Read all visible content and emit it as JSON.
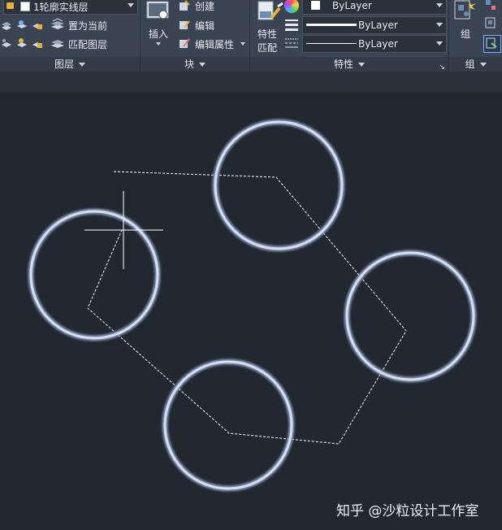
{
  "ribbon": {
    "layers_panel": {
      "title": "图层",
      "current_layer": "1轮廓实线层",
      "set_current": "置为当前",
      "match_layer": "匹配图层"
    },
    "block_panel": {
      "title": "块",
      "insert": "插入",
      "create": "创建",
      "edit": "编辑",
      "edit_attributes": "编辑属性"
    },
    "properties_panel": {
      "title": "特性",
      "match_properties": "特性\n匹配",
      "match_line1": "特性",
      "match_line2": "匹配",
      "color": "ByLayer",
      "lineweight": "ByLayer",
      "linetype": "ByLayer"
    },
    "groups_panel": {
      "title": "组",
      "group": "组"
    }
  },
  "watermark": "知乎 @沙粒设计工作室",
  "colors": {
    "ribbon_bg": "#3b4453",
    "canvas_bg": "#212830",
    "circle_stroke": "#c9d3ec",
    "dashed_line": "#ffffff"
  }
}
